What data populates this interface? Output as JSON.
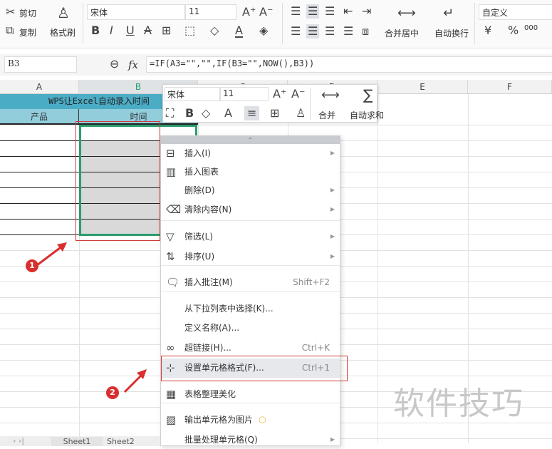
{
  "ribbon": {
    "cut": "剪切",
    "copy": "复制",
    "format_painter": "格式刷",
    "font_name": "宋体",
    "font_size": "11",
    "merge_center": "合并居中",
    "wrap_text": "自动换行",
    "number_format": "自定义",
    "currency": "¥",
    "percent": "%",
    "thousands": "000"
  },
  "formula_bar": {
    "cell_ref": "B3",
    "fx": "fx",
    "formula": "=IF(A3=\"\",\"\",IF(B3=\"\",NOW(),B3))"
  },
  "columns": [
    "A",
    "B",
    "C",
    "D",
    "E",
    "F"
  ],
  "sheet": {
    "title": "WPS让Excel自动录入时间",
    "header_a": "产品",
    "header_b": "时间"
  },
  "mini_toolbar": {
    "font_name": "宋体",
    "font_size": "11",
    "merge": "合并",
    "autosum": "自动求和"
  },
  "context_menu": {
    "items": [
      {
        "label": "插入(I)",
        "icon": "insert-icon",
        "submenu": true
      },
      {
        "label": "插入图表",
        "icon": "chart-icon"
      },
      {
        "label": "删除(D)",
        "submenu": true
      },
      {
        "label": "清除内容(N)",
        "icon": "eraser-icon",
        "submenu": true
      },
      {
        "label": "筛选(L)",
        "icon": "filter-icon",
        "submenu": true
      },
      {
        "label": "排序(U)",
        "icon": "sort-icon",
        "submenu": true
      },
      {
        "label": "插入批注(M)",
        "icon": "comment-icon",
        "shortcut": "Shift+F2"
      },
      {
        "label": "从下拉列表中选择(K)..."
      },
      {
        "label": "定义名称(A)..."
      },
      {
        "label": "超链接(H)...",
        "icon": "link-icon",
        "shortcut": "Ctrl+K"
      },
      {
        "label": "设置单元格格式(F)...",
        "icon": "format-cells-icon",
        "shortcut": "Ctrl+1"
      },
      {
        "label": "表格整理美化",
        "icon": "beautify-icon"
      },
      {
        "label": "输出单元格为图片",
        "icon": "image-export-icon"
      },
      {
        "label": "批量处理单元格(Q)",
        "submenu": true
      }
    ]
  },
  "annotations": {
    "step1": "1",
    "step2": "2"
  },
  "sheet_tabs": [
    "Sheet1",
    "Sheet2"
  ],
  "watermark": "软件技巧",
  "colors": {
    "accent": "#2a9d6f",
    "title_bg": "#4bacc6",
    "header_bg": "#92cddc",
    "annotation": "#d92f2f"
  }
}
